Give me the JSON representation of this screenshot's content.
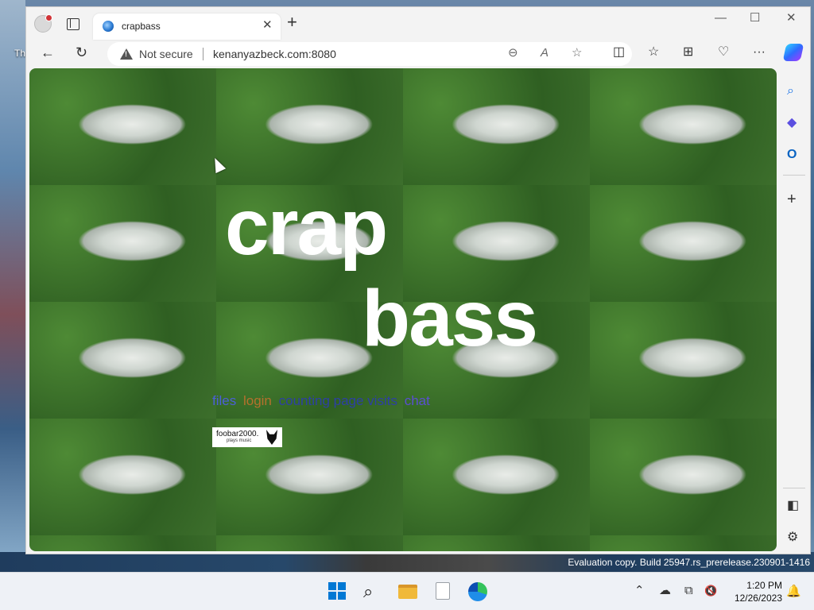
{
  "desktop": {
    "partial_label": "Th",
    "eval_watermark": "Evaluation copy. Build 25947.rs_prerelease.230901-1416"
  },
  "browser": {
    "tab": {
      "title": "crapbass",
      "close_glyph": "✕"
    },
    "new_tab_glyph": "+",
    "window_controls": {
      "minimize": "—",
      "maximize": "☐",
      "close": "✕"
    },
    "nav": {
      "back": "←",
      "refresh": "↻"
    },
    "address": {
      "security_label": "Not secure",
      "url": "kenanyazbeck.com:8080",
      "zoom_icon": "⊖",
      "read_aloud_icon": "A",
      "favorite_icon": "☆"
    },
    "toolbar_icons": {
      "split_screen": "◫",
      "favorites": "☆",
      "collections": "⊞",
      "browser_essentials": "♡",
      "more": "···"
    },
    "sidebar": {
      "search": "⌕",
      "copilot": "◆",
      "outlook": "O",
      "add": "+",
      "panel": "◧",
      "settings": "⚙"
    }
  },
  "page": {
    "title_line1": "crap",
    "title_line2": "bass",
    "links": [
      {
        "label": "files"
      },
      {
        "label": "login"
      },
      {
        "label": "counting page visits"
      },
      {
        "label": "chat"
      }
    ],
    "badge": {
      "name": "foobar2000.",
      "tagline": "plays music"
    }
  },
  "taskbar": {
    "tray": {
      "chevron": "⌃",
      "onedrive": "☁",
      "display": "⧉",
      "volume": "🔇"
    },
    "time": "1:20 PM",
    "date": "12/26/2023",
    "notification_icon": "🔔"
  },
  "colors": {
    "link_files": "#4b5fd9",
    "link_login": "#b5702d",
    "link_counting": "#2d3fa6",
    "link_chat": "#5a4fd1",
    "accent": "#0078d4"
  }
}
